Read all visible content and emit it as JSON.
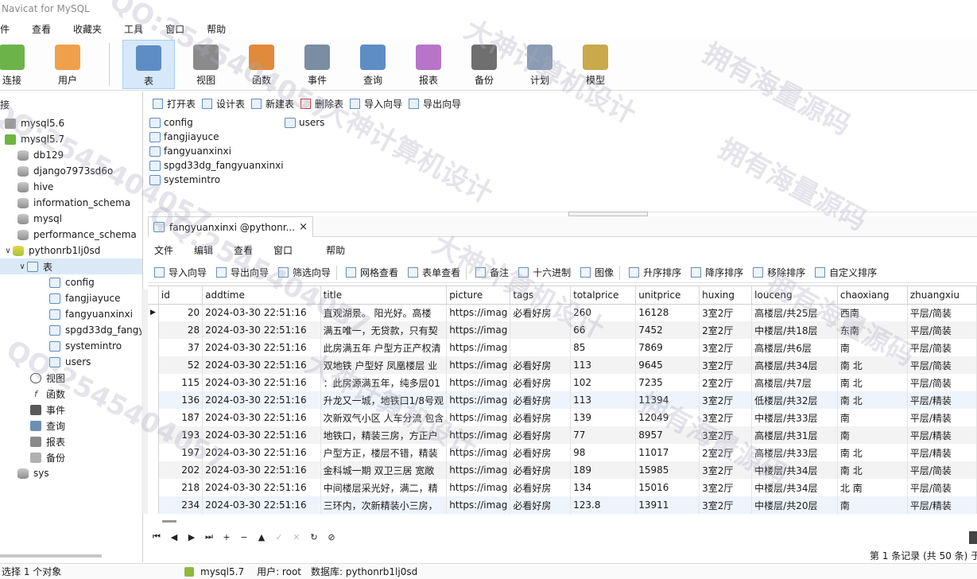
{
  "window": {
    "title": "Navicat for MySQL"
  },
  "menubar": [
    "件",
    "查看",
    "收藏夹",
    "工具",
    "窗口",
    "帮助"
  ],
  "toolbar": {
    "buttons": [
      {
        "label": "连接",
        "icon": "connect-icon",
        "color": "#6cb44a"
      },
      {
        "label": "用户",
        "icon": "user-icon",
        "color": "#f0a04b"
      },
      {
        "label": "表",
        "icon": "table-icon",
        "color": "#5d8dc4",
        "active": true
      },
      {
        "label": "视图",
        "icon": "view-icon",
        "color": "#8a8a8a"
      },
      {
        "label": "函数",
        "icon": "function-icon",
        "color": "#e08a3c"
      },
      {
        "label": "事件",
        "icon": "event-icon",
        "color": "#7a8da3"
      },
      {
        "label": "查询",
        "icon": "query-icon",
        "color": "#5d8dc4"
      },
      {
        "label": "报表",
        "icon": "report-icon",
        "color": "#b874c9"
      },
      {
        "label": "备份",
        "icon": "backup-icon",
        "color": "#6f6f6f"
      },
      {
        "label": "计划",
        "icon": "schedule-icon",
        "color": "#8a9bb3"
      },
      {
        "label": "模型",
        "icon": "model-icon",
        "color": "#c9a94a"
      }
    ]
  },
  "sidebar": {
    "header": "接",
    "tree": [
      {
        "label": "mysql5.6",
        "icon": "connection-icon",
        "type": "conn",
        "level": 0
      },
      {
        "label": "mysql5.7",
        "icon": "connection-active-icon",
        "type": "conn-on",
        "level": 0
      },
      {
        "label": "db129",
        "icon": "database-icon",
        "type": "db",
        "level": 1
      },
      {
        "label": "django7973sd6o",
        "icon": "database-icon",
        "type": "db",
        "level": 1
      },
      {
        "label": "hive",
        "icon": "database-icon",
        "type": "db",
        "level": 1
      },
      {
        "label": "information_schema",
        "icon": "database-icon",
        "type": "db",
        "level": 1
      },
      {
        "label": "mysql",
        "icon": "database-icon",
        "type": "db",
        "level": 1
      },
      {
        "label": "performance_schema",
        "icon": "database-icon",
        "type": "db",
        "level": 1
      },
      {
        "label": "pythonrb1lj0sd",
        "icon": "database-open-icon",
        "type": "db-on",
        "level": 1,
        "expanded": true
      },
      {
        "label": "表",
        "icon": "tables-group-icon",
        "type": "tbl-grp",
        "level": 2,
        "expanded": true,
        "selected": true
      },
      {
        "label": "config",
        "icon": "table-icon",
        "type": "tbl",
        "level": 3
      },
      {
        "label": "fangjiayuce",
        "icon": "table-icon",
        "type": "tbl",
        "level": 3
      },
      {
        "label": "fangyuanxinxi",
        "icon": "table-icon",
        "type": "tbl",
        "level": 3
      },
      {
        "label": "spgd33dg_fangyuanxinxi",
        "icon": "table-icon",
        "type": "tbl",
        "level": 3
      },
      {
        "label": "systemintro",
        "icon": "table-icon",
        "type": "tbl",
        "level": 3
      },
      {
        "label": "users",
        "icon": "table-icon",
        "type": "tbl",
        "level": 3
      },
      {
        "label": "视图",
        "icon": "view-icon",
        "type": "view",
        "level": 2
      },
      {
        "label": "函数",
        "icon": "function-icon",
        "type": "func",
        "level": 2
      },
      {
        "label": "事件",
        "icon": "event-icon",
        "type": "evt",
        "level": 2
      },
      {
        "label": "查询",
        "icon": "query-icon",
        "type": "qry",
        "level": 2
      },
      {
        "label": "报表",
        "icon": "report-icon",
        "type": "rpt",
        "level": 2
      },
      {
        "label": "备份",
        "icon": "backup-icon",
        "type": "bak",
        "level": 2
      },
      {
        "label": "sys",
        "icon": "database-icon",
        "type": "db",
        "level": 1
      }
    ]
  },
  "object_toolbar": [
    {
      "label": "打开表",
      "icon": "open-table-icon"
    },
    {
      "label": "设计表",
      "icon": "design-table-icon"
    },
    {
      "label": "新建表",
      "icon": "new-table-icon"
    },
    {
      "label": "删除表",
      "icon": "delete-table-icon"
    },
    {
      "label": "导入向导",
      "icon": "import-wizard-icon"
    },
    {
      "label": "导出向导",
      "icon": "export-wizard-icon"
    }
  ],
  "objects": [
    "config",
    "fangjiayuce",
    "fangyuanxinxi",
    "spgd33dg_fangyuanxinxi",
    "systemintro",
    "users"
  ],
  "tab": {
    "label": "fangyuanxinxi @pythonr...",
    "close": "×"
  },
  "inner_menu": [
    "文件",
    "编辑",
    "查看",
    "窗口",
    "帮助"
  ],
  "inner_toolbar": [
    {
      "label": "导入向导",
      "icon": "import-icon"
    },
    {
      "label": "导出向导",
      "icon": "export-icon"
    },
    {
      "label": "筛选向导",
      "icon": "filter-icon"
    },
    {
      "label": "网格查看",
      "icon": "grid-view-icon"
    },
    {
      "label": "表单查看",
      "icon": "form-view-icon"
    },
    {
      "label": "备注",
      "icon": "memo-icon"
    },
    {
      "label": "十六进制",
      "icon": "hex-icon"
    },
    {
      "label": "图像",
      "icon": "image-icon"
    },
    {
      "label": "升序排序",
      "icon": "sort-asc-icon"
    },
    {
      "label": "降序排序",
      "icon": "sort-desc-icon"
    },
    {
      "label": "移除排序",
      "icon": "remove-sort-icon"
    },
    {
      "label": "自定义排序",
      "icon": "custom-sort-icon"
    }
  ],
  "grid": {
    "columns": [
      "id",
      "addtime",
      "title",
      "picture",
      "tags",
      "totalprice",
      "unitprice",
      "huxing",
      "louceng",
      "chaoxiang",
      "zhuangxiu"
    ],
    "rows": [
      [
        "20",
        "2024-03-30 22:51:16",
        "直观湖景。 阳光好。高楼",
        "https://imag",
        "必看好房",
        "260",
        "16128",
        "3室2厅",
        "高楼层/共25层",
        "西南",
        "平层/简装"
      ],
      [
        "28",
        "2024-03-30 22:51:16",
        "满五唯一，无贷款，只有契",
        "https://imag",
        "",
        "66",
        "7452",
        "2室2厅",
        "中楼层/共18层",
        "东南",
        "平层/简装"
      ],
      [
        "37",
        "2024-03-30 22:51:16",
        "此房满五年 户型方正产权清",
        "https://imag",
        "",
        "85",
        "7869",
        "3室2厅",
        "高楼层/共6层",
        "南",
        "平层/简装"
      ],
      [
        "52",
        "2024-03-30 22:51:16",
        "双地铁 户型好 凤凰楼层 业",
        "https://imag",
        "必看好房",
        "113",
        "9645",
        "3室2厅",
        "高楼层/共34层",
        "南 北",
        "平层/简装"
      ],
      [
        "115",
        "2024-03-30 22:51:16",
        "：此房源满五年，纯多层01",
        "https://imag",
        "必看好房",
        "102",
        "7235",
        "2室2厅",
        "高楼层/共7层",
        "南 北",
        "平层/简装"
      ],
      [
        "136",
        "2024-03-30 22:51:16",
        "升龙又一城，地铁口1/8号观",
        "https://imag",
        "必看好房",
        "113",
        "11394",
        "3室2厅",
        "低楼层/共32层",
        "南 北",
        "平层/精装"
      ],
      [
        "187",
        "2024-03-30 22:51:16",
        "次新双气小区 人车分流 包含",
        "https://imag",
        "必看好房",
        "139",
        "12049",
        "3室2厅",
        "中楼层/共33层",
        "南",
        "平层/精装"
      ],
      [
        "193",
        "2024-03-30 22:51:16",
        "地铁口，精装三房，方正户",
        "https://imag",
        "必看好房",
        "77",
        "8957",
        "3室2厅",
        "高楼层/共31层",
        "南",
        "平层/精装"
      ],
      [
        "197",
        "2024-03-30 22:51:16",
        "户型方正，楼层不错，精装",
        "https://imag",
        "必看好房",
        "98",
        "11017",
        "2室2厅",
        "高楼层/共33层",
        "南 北",
        "平层/精装"
      ],
      [
        "202",
        "2024-03-30 22:51:16",
        "金科城一期 双卫三居 宽敞",
        "https://imag",
        "必看好房",
        "189",
        "15985",
        "3室2厅",
        "中楼层/共34层",
        "南 北",
        "平层/简装"
      ],
      [
        "218",
        "2024-03-30 22:51:16",
        "中间楼层采光好，满二，精",
        "https://imag",
        "必看好房",
        "134",
        "15016",
        "3室2厅",
        "中楼层/共34层",
        "北 南",
        "平层/简装"
      ],
      [
        "234",
        "2024-03-30 22:51:16",
        "三环内，次新精装小三房，",
        "https://imag",
        "必看好房",
        "123.8",
        "13911",
        "3室2厅",
        "中楼层/共20层",
        "南",
        "平层/精装"
      ]
    ]
  },
  "navbar": [
    "⏮",
    "◀",
    "▶",
    "⏭",
    "+",
    "−",
    "▲",
    "✓",
    "✕",
    "↻",
    "⊘"
  ],
  "record_info": "第 1 条记录 (共 50 条) 于",
  "status": {
    "selection": "选择 1 个对象",
    "connection": "mysql5.7",
    "user": "用户: root",
    "database": "数据库: pythonrb1lj0sd"
  },
  "watermarks": [
    "QQ:2545404057",
    "大神计算机设计",
    "拥有海量源码",
    "QQ:2545404057",
    "大神计算机设计",
    "拥有海量源码",
    "QQ:2545404057",
    "大神计算机设计",
    "拥有海量源码",
    "QQ:2545404057",
    "大神计算机设计",
    "拥有海量源码"
  ]
}
